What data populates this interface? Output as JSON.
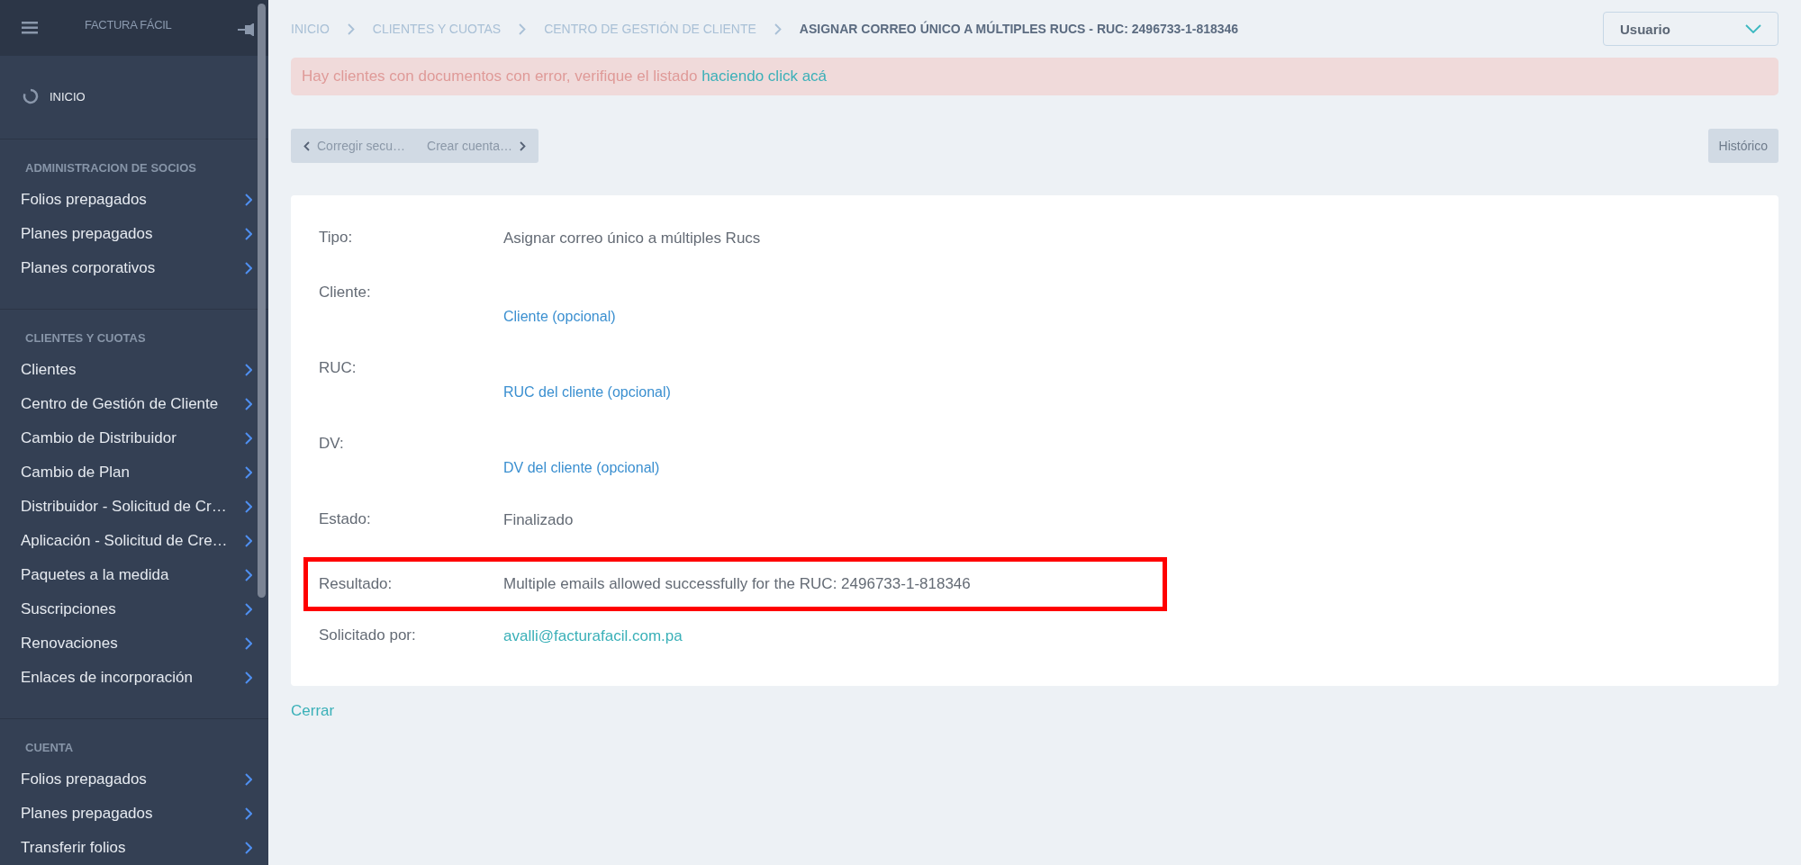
{
  "sidebar": {
    "title": "FACTURA FÁCIL",
    "home": "INICIO",
    "sections": [
      {
        "title": "ADMINISTRACION DE SOCIOS",
        "items": [
          {
            "label": "Folios prepagados"
          },
          {
            "label": "Planes prepagados"
          },
          {
            "label": "Planes corporativos"
          }
        ]
      },
      {
        "title": "CLIENTES Y CUOTAS",
        "items": [
          {
            "label": "Clientes"
          },
          {
            "label": "Centro de Gestión de Cliente"
          },
          {
            "label": "Cambio de Distribuidor"
          },
          {
            "label": "Cambio de Plan"
          },
          {
            "label": "Distribuidor - Solicitud de Cr…"
          },
          {
            "label": "Aplicación - Solicitud de Cre…"
          },
          {
            "label": "Paquetes a la medida"
          },
          {
            "label": "Suscripciones"
          },
          {
            "label": "Renovaciones"
          },
          {
            "label": "Enlaces de incorporación"
          }
        ]
      },
      {
        "title": "CUENTA",
        "items": [
          {
            "label": "Folios prepagados"
          },
          {
            "label": "Planes prepagados"
          },
          {
            "label": "Transferir folios"
          }
        ]
      }
    ]
  },
  "breadcrumb": [
    {
      "label": "INICIO",
      "current": false
    },
    {
      "label": "CLIENTES Y CUOTAS",
      "current": false
    },
    {
      "label": "CENTRO DE GESTIÓN DE CLIENTE",
      "current": false
    },
    {
      "label": "ASIGNAR CORREO ÚNICO A MÚLTIPLES RUCS - RUC: 2496733-1-818346",
      "current": true
    }
  ],
  "user_menu": {
    "label": "Usuario"
  },
  "alert": {
    "text": "Hay clientes con documentos con error, verifique el listado",
    "link": "haciendo click acá"
  },
  "pager": {
    "previous": "Corregir secu…",
    "next": "Crear cuenta…"
  },
  "history_button": "Histórico",
  "details": [
    {
      "label": "Tipo:",
      "value": "Asignar correo único a múltiples Rucs",
      "kind": "text",
      "highlighted": false
    },
    {
      "label": "Cliente:",
      "value": "Cliente (opcional)",
      "kind": "placeholder",
      "highlighted": false
    },
    {
      "label": "RUC:",
      "value": "RUC del cliente (opcional)",
      "kind": "placeholder",
      "highlighted": false
    },
    {
      "label": "DV:",
      "value": "DV del cliente (opcional)",
      "kind": "placeholder",
      "highlighted": false
    },
    {
      "label": "Estado:",
      "value": "Finalizado",
      "kind": "text",
      "highlighted": false
    },
    {
      "label": "Resultado:",
      "value": "Multiple emails allowed successfully for the RUC: 2496733-1-818346",
      "kind": "text",
      "highlighted": true
    },
    {
      "label": "Solicitado por:",
      "value": "avalli@facturafacil.com.pa",
      "kind": "link",
      "highlighted": false
    }
  ],
  "close_link": "Cerrar"
}
